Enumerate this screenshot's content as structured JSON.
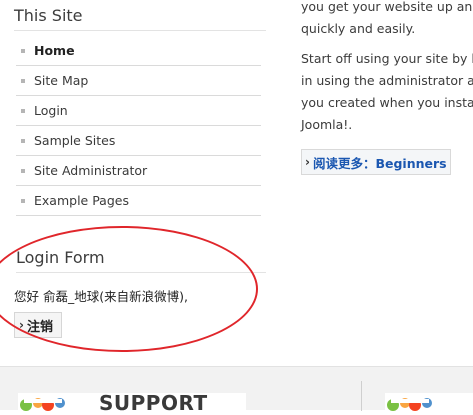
{
  "sidebar": {
    "site_title": "This Site",
    "items": [
      {
        "label": "Home",
        "active": true
      },
      {
        "label": "Site Map"
      },
      {
        "label": "Login"
      },
      {
        "label": "Sample Sites"
      },
      {
        "label": "Site Administrator"
      },
      {
        "label": "Example Pages"
      }
    ]
  },
  "login": {
    "title": "Login Form",
    "greeting": "您好 俞磊_地球(来自新浪微博),",
    "logout_label": "注销"
  },
  "content": {
    "para1_line1": "you get your website up and r",
    "para1_line2": "quickly and easily.",
    "para2_line1": "Start off using your site by log",
    "para2_line2": "in using the administrator acc",
    "para2_line3": "you created when you installe",
    "para2_line4": "Joomla!.",
    "readmore": "阅读更多：Beginners"
  },
  "footer": {
    "support_label": "SUPPORT"
  },
  "colors": {
    "annotation_circle": "#e0262b",
    "link": "#1b57b1",
    "logo_green": "#7ac143",
    "logo_orange": "#f9a541"
  }
}
